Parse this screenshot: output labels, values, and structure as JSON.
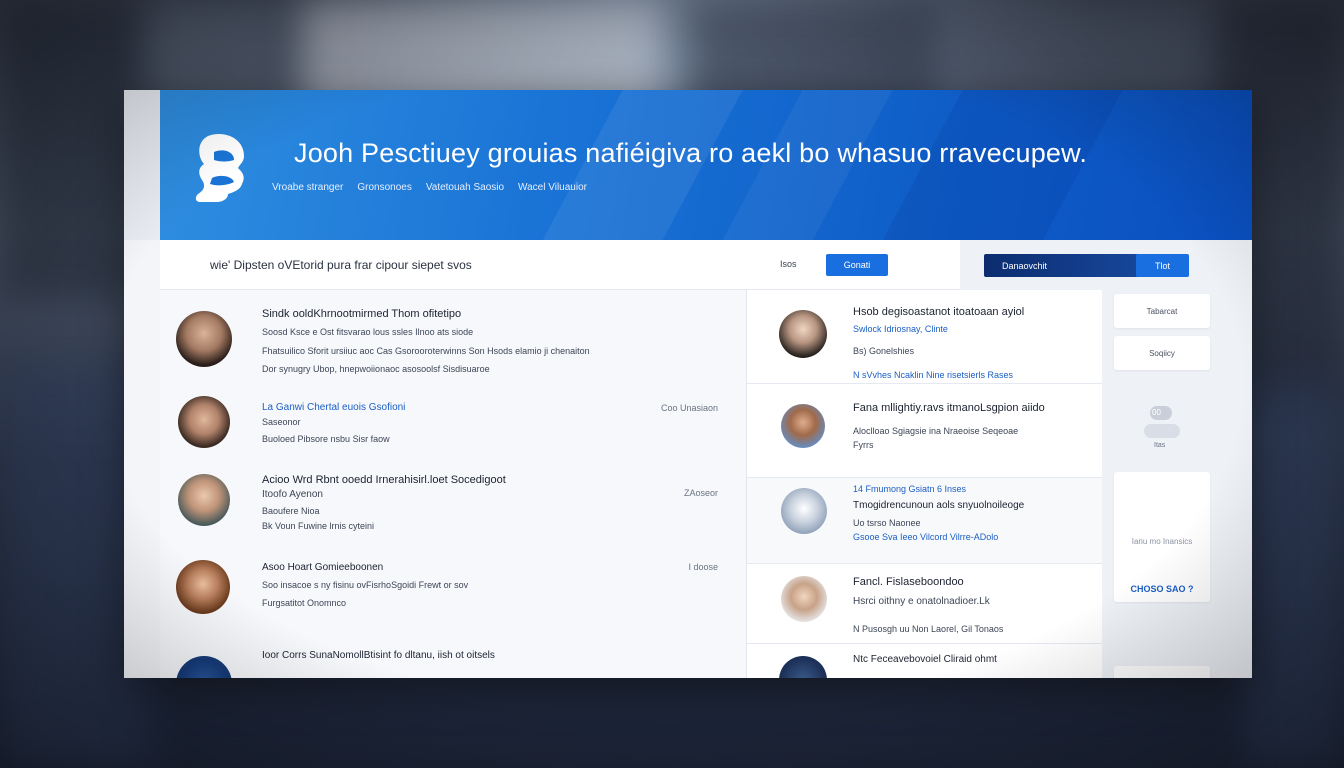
{
  "colors": {
    "banner_start": "#2f8ee0",
    "banner_end": "#0a4fc0",
    "accent": "#1a6fe0",
    "dark_bar": "#0c2c6e",
    "link": "#1b5fc4"
  },
  "banner": {
    "logo_icon": "head-profile-logo-icon",
    "title": "Jooh Pesctiuey grouias nafiéigiva ro aekl bo whasuo rravecupew.",
    "nav": [
      "Vroabe stranger",
      "Gronsonoes",
      "Vatetouah Saosio",
      "Wacel Viluauior"
    ]
  },
  "toolbar": {
    "text": "wie' Dipsten oVEtorid pura frar cipour siepet svos",
    "hint": "Isos",
    "button_label": "Gonati"
  },
  "right_top": {
    "dark_bar_label": "Danaovchit",
    "button_label": "Tlot"
  },
  "people": [
    {
      "title": "Sindk ooldKhrnootmirmed Thom ofitetipo",
      "line2": "Soosd Ksce e Ost fitsvarao lous ssles Ilnoo ats siode",
      "line3": "Fhatsuilico Sforit ursiiuc aoc Cas Gsorooroterwinns Son Hsods elamio ji chenaiton",
      "line4": "Dor synugry Ubop, hnepwoiionaoc asosoolsf Sisdisuaroe",
      "meta": ""
    },
    {
      "title": "La Ganwi Chertal euois Gsofioni",
      "line2": "Saseonor",
      "line3": "Buoloed Pibsore nsbu Sisr faow",
      "line4": "",
      "meta": "Coo Unasiaon"
    },
    {
      "title": "Acioo Wrd Rbnt ooedd Irnerahisirl.loet Socedigoot",
      "line2": "Itoofo Ayenon",
      "line3": "Baoufere Nioa",
      "line4": "Bk Voun Fuwine lrnis cyteini",
      "meta": "ZAoseor"
    },
    {
      "title": "Asoo Hoart Gomieeboonen",
      "line2": "Soo insacoe s ny fisinu ovFisrhoSgoidi Frewt or sov",
      "line3": "Furgsatitot Onomnco",
      "line4": "",
      "meta": "I doose"
    },
    {
      "title": "Ioor Corrs SunaNomollBtisint fo dltanu, iish ot oitsels",
      "line2": "",
      "line3": "",
      "line4": "",
      "meta": ""
    }
  ],
  "mid_items": [
    {
      "title": "Hsob degisoastanot itoatoaan ayiol",
      "line2": "Swlock Idriosnay, Clinte",
      "line3": "Bs) Gonelshies",
      "line4": "N sVvhes Ncaklin Nine risetsierls Rases"
    },
    {
      "title": "Fana mllightiy.ravs itmanoLsgpion aiido",
      "line2": "Aloclloao Sgiagsie ina Nraeoise Seqeoae",
      "line3": "Fyrrs",
      "line4": ""
    },
    {
      "title": "14 Fmumong Gsiatn 6 Inses",
      "line2": "Tmogidrencunoun aols snyuolnoileoge",
      "line3": "Uo tsrso Naonee",
      "line4": "Gsooe Sva Ieeo Vilcord Vilrre-ADolo"
    },
    {
      "title": "Fancl. Fislaseboondoo",
      "line2": "Hsrci oithny e onatolnadioer.Lk",
      "line3": "",
      "line4": "N Pusosgh uu Non Laorel, Gil Tonaos"
    },
    {
      "title": "Ntc Feceavebovoiel Cliraid ohmt",
      "line2": "",
      "line3": "",
      "line4": ""
    }
  ],
  "side": {
    "card1": "Tabarcat",
    "card2": "Soqiicy",
    "card3_badge": "00",
    "card3_caption": "Itas",
    "card4": "Ianu mo Inansics",
    "link": "CHOSO SAO ?"
  }
}
